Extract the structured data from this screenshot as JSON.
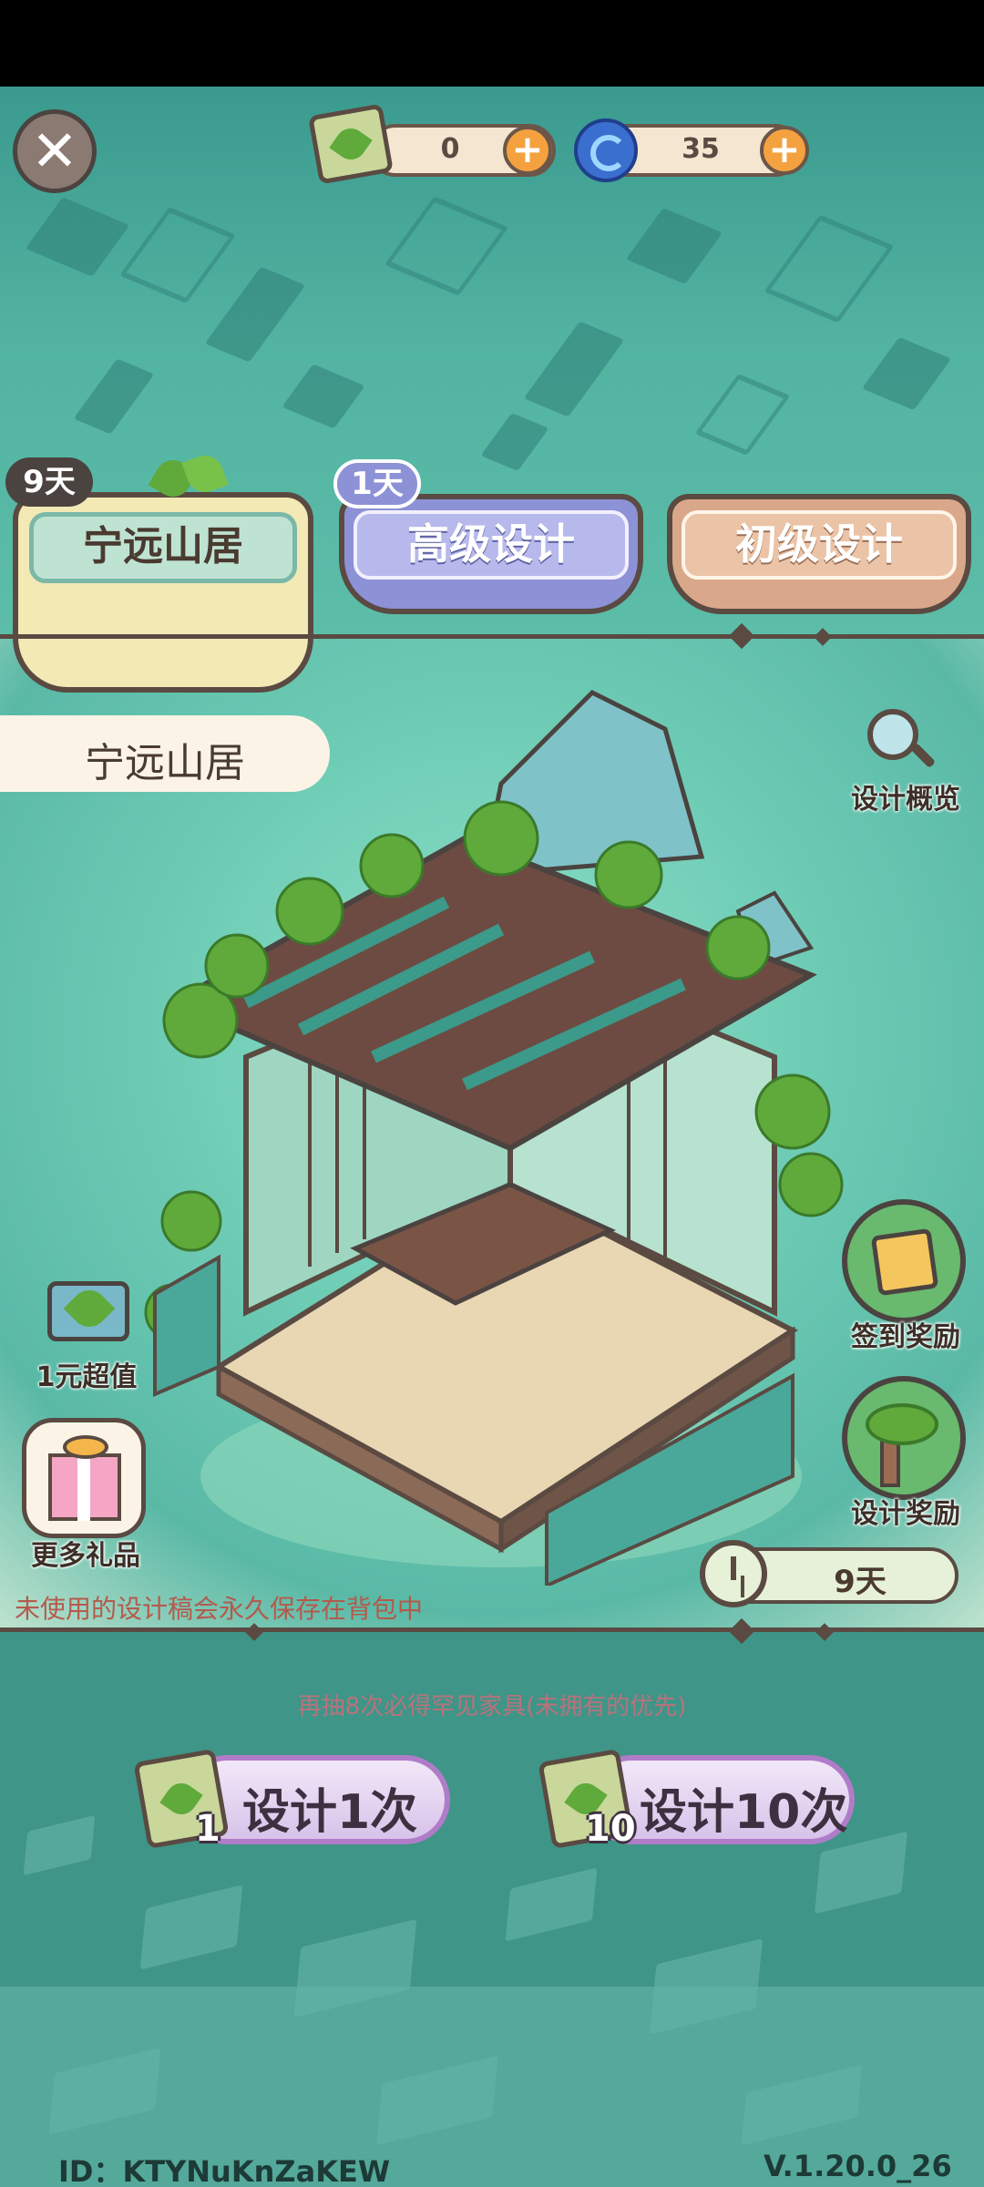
{
  "currency": {
    "scroll_count": "0",
    "swirl_count": "35",
    "add_symbol": "+"
  },
  "close_symbol": "✕",
  "tabs": [
    {
      "label": "宁远山居",
      "badge": "9天"
    },
    {
      "label": "高级设计",
      "badge": "1天"
    },
    {
      "label": "初级设计",
      "badge": ""
    }
  ],
  "banner_title": "宁远山居",
  "side_buttons": {
    "overview": "设计概览",
    "recharge": "1元超值",
    "more_gifts": "更多礼品",
    "checkin_reward": "签到奖励",
    "design_reward": "设计奖励"
  },
  "timer_text": "9天",
  "note_text": "未使用的设计稿会永久保存在背包中",
  "hint_text": "再抽8次必得罕见家具(未拥有的优先)",
  "draw_buttons": [
    {
      "label": "设计1次",
      "cost": "1"
    },
    {
      "label": "设计10次",
      "cost": "10"
    }
  ],
  "footer": {
    "id_text": "ID：KTYNuKnZaKEW",
    "version": "V.1.20.0_26"
  },
  "colors": {
    "teal_bg": "#52b3a1",
    "dark_teal": "#3f9587",
    "tab_active": "#f3e9b5",
    "tab_purple": "#8d91d6",
    "tab_brown": "#d9a88a",
    "outline": "#5a4a42"
  },
  "icons": [
    "close-icon",
    "scroll-icon",
    "swirl-currency-icon",
    "plus-icon",
    "magnifier-icon",
    "calendar-icon",
    "bonsai-icon",
    "gift-box-icon",
    "clock-icon"
  ]
}
